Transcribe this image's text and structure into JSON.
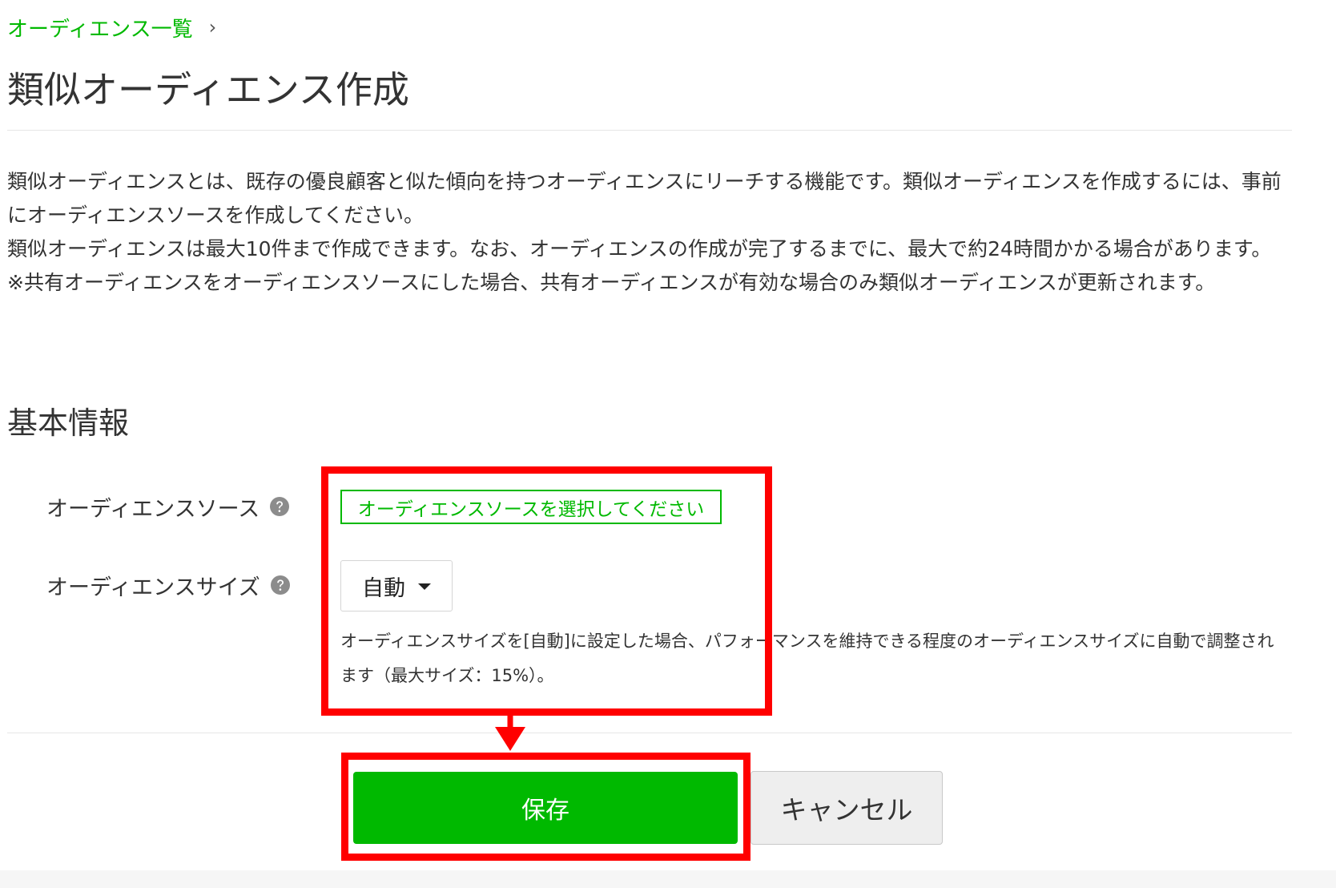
{
  "breadcrumb": {
    "link_label": "オーディエンス一覧",
    "separator": "›"
  },
  "page": {
    "title": "類似オーディエンス作成"
  },
  "description": {
    "line1": "類似オーディエンスとは、既存の優良顧客と似た傾向を持つオーディエンスにリーチする機能です。類似オーディエンスを作成するには、事前にオーディエンスソースを作成してください。",
    "line2": "類似オーディエンスは最大10件まで作成できます。なお、オーディエンスの作成が完了するまでに、最大で約24時間かかる場合があります。",
    "line3": "※共有オーディエンスをオーディエンスソースにした場合、共有オーディエンスが有効な場合のみ類似オーディエンスが更新されます。"
  },
  "section": {
    "title": "基本情報"
  },
  "form": {
    "source_label": "オーディエンスソース",
    "source_button_label": "オーディエンスソースを選択してください",
    "size_label": "オーディエンスサイズ",
    "size_selected": "自動",
    "size_note": "オーディエンスサイズを[自動]に設定した場合、パフォーマンスを維持できる程度のオーディエンスサイズに自動で調整されます（最大サイズ：15%）。"
  },
  "actions": {
    "save_label": "保存",
    "cancel_label": "キャンセル"
  },
  "icons": {
    "help": "question-circle-icon",
    "dropdown": "caret-down-icon",
    "breadcrumb_separator": "chevron-right-icon"
  },
  "colors": {
    "brand_green": "#00b900",
    "annotation_red": "#ff0000",
    "help_icon_gray": "#8c8c8c",
    "cancel_background": "#eeeeee"
  }
}
